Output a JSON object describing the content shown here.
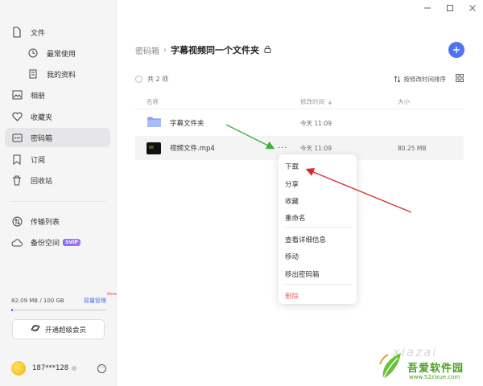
{
  "sidebar": {
    "items": [
      {
        "label": "文件"
      },
      {
        "label": "最常使用"
      },
      {
        "label": "我的资料"
      },
      {
        "label": "相册"
      },
      {
        "label": "收藏夹"
      },
      {
        "label": "密码箱"
      },
      {
        "label": "订阅"
      },
      {
        "label": "回收站"
      },
      {
        "label": "传输列表"
      },
      {
        "label": "备份空间",
        "badge": "SVIP"
      }
    ],
    "storage": {
      "used_text": "82.09 MB / 100 GB",
      "manage_label": "容量管理",
      "new_badge": "New",
      "used_fraction": 0.0008
    },
    "vip_button": "开通超级会员",
    "user": {
      "name": "187***128"
    }
  },
  "main": {
    "breadcrumb": {
      "root": "密码箱",
      "separator": "›",
      "current": "字幕视频同一个文件夹"
    },
    "toolbar": {
      "count": "共 2 项",
      "sort_label": "按修改时间排序"
    },
    "columns": {
      "name": "名称",
      "modified": "修改时间",
      "size": "大小"
    },
    "files": [
      {
        "name": "字幕文件夹",
        "modified": "今天 11:09",
        "size": "",
        "type": "folder"
      },
      {
        "name": "视频文件.mp4",
        "modified": "今天 11:09",
        "size": "80.25 MB",
        "type": "video"
      }
    ]
  },
  "context_menu": {
    "items": [
      "下载",
      "分享",
      "收藏",
      "重命名",
      "查看详细信息",
      "移动",
      "移出密码箱",
      "删除"
    ]
  },
  "watermark": {
    "title": "吾爱软件园",
    "url": "www.52zixue.com",
    "bg_text": "xiazai"
  },
  "colors": {
    "accent": "#4f74f0",
    "danger": "#f56c6c",
    "green_arrow": "#3cb043",
    "red_arrow": "#d42a2a"
  }
}
